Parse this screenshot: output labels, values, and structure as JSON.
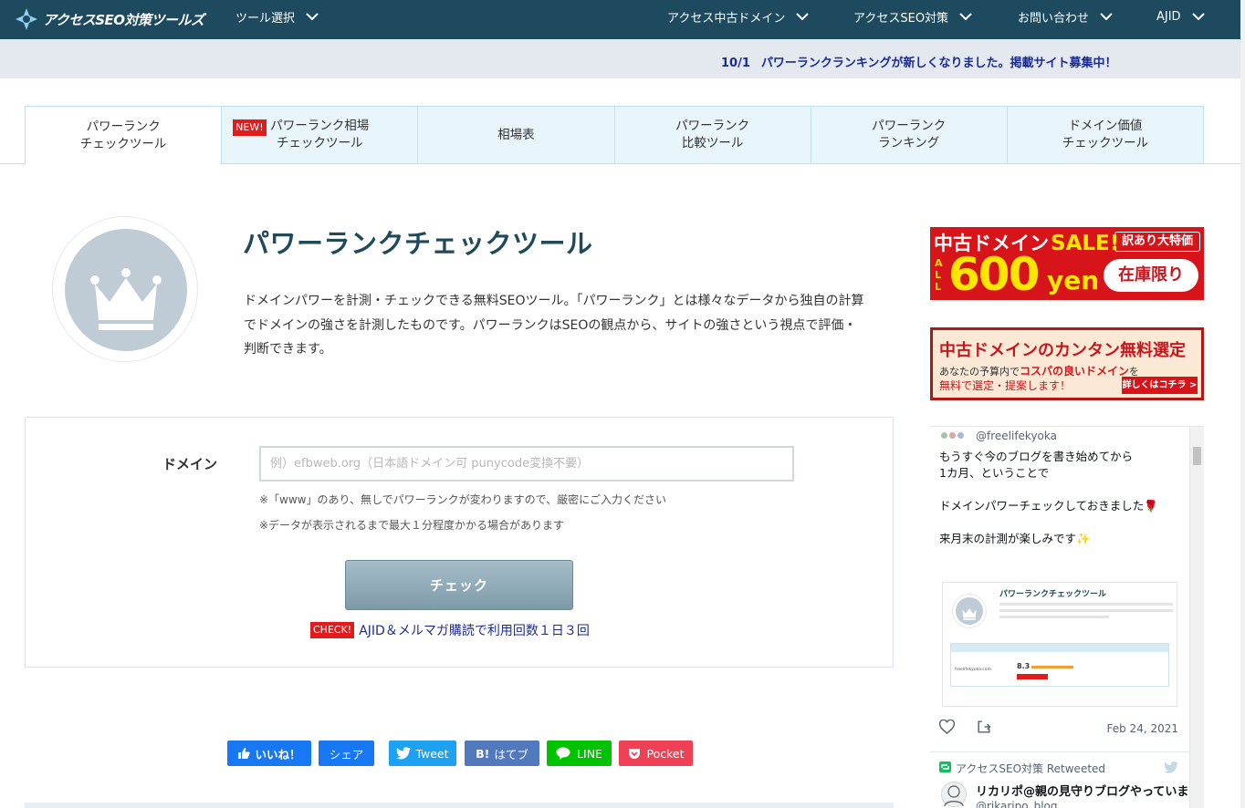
{
  "header": {
    "logo_text": "アクセスSEO対策ツールズ",
    "nav": [
      {
        "label": "ツール選択"
      },
      {
        "label": "アクセス中古ドメイン"
      },
      {
        "label": "アクセスSEO対策"
      },
      {
        "label": "お問い合わせ"
      },
      {
        "label": "AJID"
      }
    ]
  },
  "notice": {
    "date": "10/1",
    "text": "パワーランクランキングが新しくなりました。掲載サイト募集中！"
  },
  "tabs": [
    {
      "line1": "パワーランク",
      "line2": "チェックツール"
    },
    {
      "badge": "NEW!",
      "line1": "パワーランク相場",
      "line2": "チェックツール"
    },
    {
      "line1": "相場表",
      "line2": ""
    },
    {
      "line1": "パワーランク",
      "line2": "比較ツール"
    },
    {
      "line1": "パワーランク",
      "line2": "ランキング"
    },
    {
      "line1": "ドメイン価値",
      "line2": "チェックツール"
    }
  ],
  "main": {
    "title": "パワーランクチェックツール",
    "description": "ドメインパワーを計測・チェックできる無料SEOツール。「パワーランク」とは様々なデータから独自の計算でドメインの強さを計測したものです。パワーランクはSEOの観点から、サイトの強さという視点で評価・判断できます。"
  },
  "form": {
    "label": "ドメイン",
    "placeholder": "例）efbweb.org（日本語ドメイン可 punycode変換不要）",
    "value": "",
    "note1": "※「www」のあり、無しでパワーランクが変わりますので、厳密にご入力ください",
    "note2": "※データが表示されるまで最大１分程度かかる場合があります",
    "button": "チェック",
    "check_badge": "CHECK!",
    "check_text": "AJID＆メルマガ購読で利用回数１日３回"
  },
  "share": [
    {
      "label": "いいね！",
      "color": "#1877f2"
    },
    {
      "label": "シェア",
      "color": "#1877f2"
    },
    {
      "label": "Tweet",
      "color": "#1da1f2"
    },
    {
      "label": "はてブ",
      "icon": "B!",
      "color": "#5279be"
    },
    {
      "label": "LINE",
      "color": "#00c300"
    },
    {
      "label": "Pocket",
      "color": "#ef4056"
    }
  ],
  "banners": {
    "b1_title": "中古ドメイン",
    "b1_sale": "SALE!",
    "b1_tag": "訳あり大特価",
    "b1_all": "ALL",
    "b1_price": "600",
    "b1_unit": "yen",
    "b1_stock": "在庫限り",
    "b2_title": "中古ドメインのカンタン無料選定",
    "b2_line1a": "あなたの予算内で",
    "b2_line1b": "コスパの良いドメイン",
    "b2_line1c": "を",
    "b2_line2": "無料で選定・提案します！",
    "b2_cta": "詳しくはコチラ >"
  },
  "twitter": {
    "handle": "@freelifekyoka",
    "body": "もうすぐ今のブログを書き始めてから\n1カ月、ということで\n\nドメインパワーチェックしておきました🌹\n\n来月末の計測が楽しみです✨",
    "card_title": "パワーランクチェックツール",
    "card_rank": "8.3",
    "card_domain": "freelifekyoka.com",
    "date": "Feb 24, 2021",
    "retweeted_by": "アクセスSEO対策 Retweeted",
    "name2": "リカリポ@親の見守りブログやっています",
    "handle2": "@rikaripo_blog"
  }
}
